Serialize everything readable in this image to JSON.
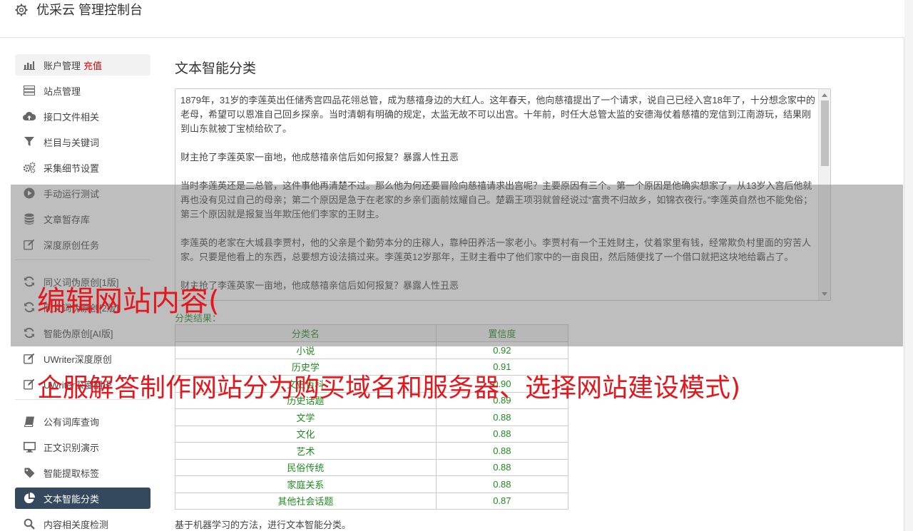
{
  "header": {
    "title": "优采云 管理控制台",
    "icon": "gear-icon"
  },
  "sidebar": {
    "group1": [
      {
        "label": "账户管理",
        "extra": "充值",
        "icon": "bar-chart-icon"
      },
      {
        "label": "站点管理",
        "icon": "server-icon"
      },
      {
        "label": "接口文件相关",
        "icon": "cloud-upload-icon"
      },
      {
        "label": "栏目与关键词",
        "icon": "filter-icon"
      },
      {
        "label": "采集细节设置",
        "icon": "gears-icon"
      },
      {
        "label": "手动运行测试",
        "icon": "play-icon"
      },
      {
        "label": "文章暂存库",
        "icon": "database-icon"
      },
      {
        "label": "深度原创任务",
        "icon": "edit-icon"
      }
    ],
    "group2": [
      {
        "label": "同义词伪原创[1版]",
        "icon": "refresh-icon"
      },
      {
        "label": "同义词伪原创[2版]",
        "icon": "refresh-icon"
      },
      {
        "label": "智能伪原创[AI版]",
        "icon": "refresh-icon"
      },
      {
        "label": "UWriter深度原创",
        "icon": "edit-icon"
      },
      {
        "label": "UWriter深度翻译",
        "icon": "edit-icon"
      }
    ],
    "group3": [
      {
        "label": "公有词库查询",
        "icon": "book-icon"
      },
      {
        "label": "正文识别演示",
        "icon": "monitor-icon"
      },
      {
        "label": "智能提取标签",
        "icon": "tag-icon"
      },
      {
        "label": "文本智能分类",
        "icon": "pie-chart-icon"
      },
      {
        "label": "内容相关度检测",
        "icon": "search-icon"
      }
    ]
  },
  "main": {
    "title": "文本智能分类",
    "text_paragraphs": [
      "1879年，31岁的李莲英出任储秀宫四品花翎总管，成为慈禧身边的大红人。这年春天，他向慈禧提出了一个请求，说自己已经入宫18年了，十分想念家中的老母，希望可以恩准自己回乡探亲。当时清朝有明确的规定，太监无故不可以出宫。十年前，时任大总管太监的安德海仗着慈禧的宠信到江南游玩，结果刚到山东就被丁宝桢给砍了。",
      "财主抢了李莲英家一亩地，他成慈禧亲信后如何报复？暴露人性丑恶",
      "当时李莲英还是二总管，这件事他再清楚不过。那么他为何还要冒险向慈禧请求出宫呢？主要原因有三个。第一个原因是他确实想家了，从13岁入宫后他就再也没有见过自己的母亲；第二个原因是急于在老家的乡亲们面前炫耀自己。楚霸王项羽就曾经说过“富贵不归故乡，如锦衣夜行。”李莲英自然也不能免俗；第三个原因就是报复当年欺压他们李家的王财主。",
      "李莲英的老家在大城县李贾村，他的父亲是个勤劳本分的庄稼人，靠种田养活一家老小。李贾村有一个王姓财主，仗着家里有钱，经常欺负村里面的穷苦人家。只要是他看上的东西，总要想方设法搞过来。李莲英12岁那年，王财主看中了他们家中的一亩良田，然后随便找了一个借口就把这块地给霸占了。",
      "财主抢了李莲英家一亩地，他成慈禧亲信后如何报复？暴露人性丑恶"
    ],
    "result_label": "分类结果：",
    "table": {
      "headers": [
        "分类名",
        "置信度"
      ],
      "rows": [
        [
          "小说",
          "0.92"
        ],
        [
          "历史学",
          "0.91"
        ],
        [
          "文史百科",
          "0.90"
        ],
        [
          "历史话题",
          "0.89"
        ],
        [
          "文学",
          "0.88"
        ],
        [
          "文化",
          "0.88"
        ],
        [
          "艺术",
          "0.88"
        ],
        [
          "民俗传统",
          "0.88"
        ],
        [
          "家庭关系",
          "0.88"
        ],
        [
          "其他社会话题",
          "0.87"
        ]
      ]
    },
    "footnote": "基于机器学习的方法，进行文本智能分类。"
  },
  "overlay": {
    "caption_line1": "编辑网站内容(",
    "caption_line2": "企服解答制作网站分为购买域名和服务器、选择网站建设模式)",
    "caption_color": "#e3171c"
  }
}
